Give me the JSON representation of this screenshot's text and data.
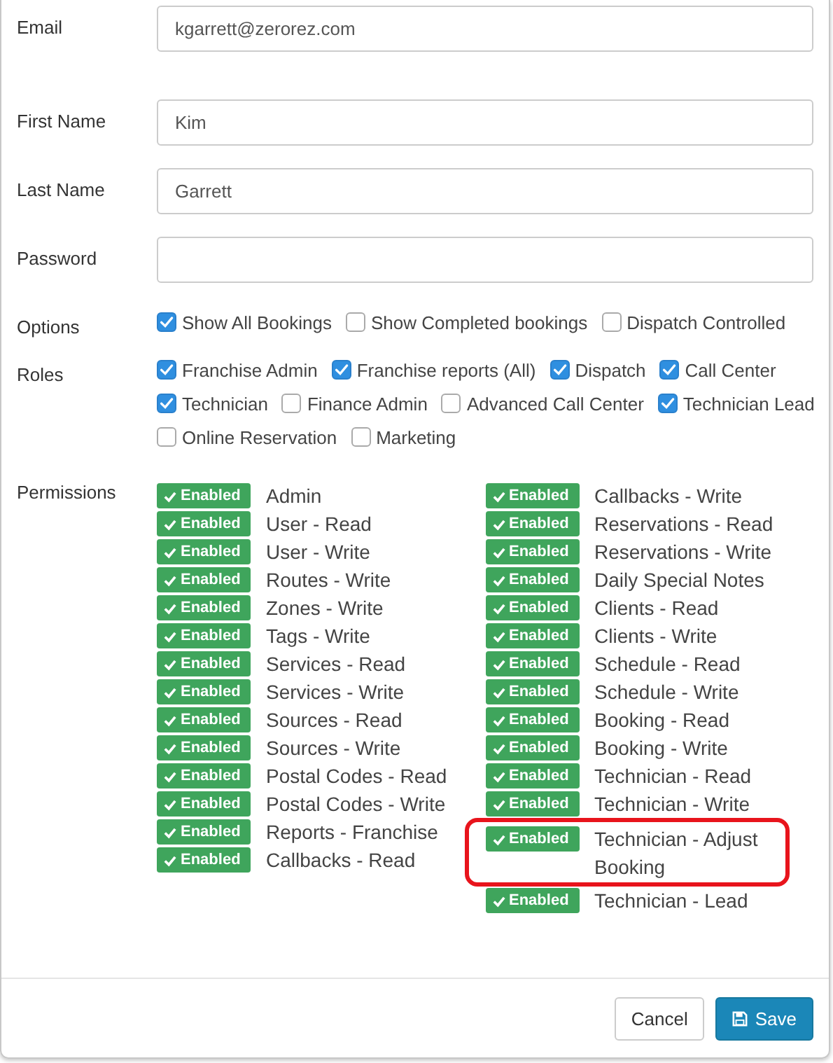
{
  "fields": [
    {
      "label": "Email",
      "value": "kgarrett@zerorez.com"
    },
    {
      "label": "First Name",
      "value": "Kim"
    },
    {
      "label": "Last Name",
      "value": "Garrett"
    },
    {
      "label": "Password"
    }
  ],
  "options": {
    "label": "Options",
    "rows": [
      [
        {
          "label": "Show All Bookings",
          "checked": true
        },
        {
          "label": "Show Completed bookings",
          "checked": false
        },
        {
          "label": "Dispatch Controlled",
          "checked": false
        }
      ]
    ]
  },
  "roles": {
    "label": "Roles",
    "rows": [
      [
        {
          "label": "Franchise Admin",
          "checked": true
        },
        {
          "label": "Franchise reports (All)",
          "checked": true
        },
        {
          "label": "Dispatch",
          "checked": true
        },
        {
          "label": "Call Center",
          "checked": true
        }
      ],
      [
        {
          "label": "Technician",
          "checked": true
        },
        {
          "label": "Finance Admin",
          "checked": false
        },
        {
          "label": "Advanced Call Center",
          "checked": false
        },
        {
          "label": "Technician Lead",
          "checked": true
        }
      ],
      [
        {
          "label": "Online Reservation",
          "checked": false
        },
        {
          "label": "Marketing",
          "checked": false
        }
      ]
    ]
  },
  "permissions": {
    "label": "Permissions",
    "columns": [
      [
        {
          "status": "Enabled",
          "enabled": true,
          "label": "Admin",
          "highlighted": false
        },
        {
          "status": "Enabled",
          "enabled": true,
          "label": "User - Read",
          "highlighted": false
        },
        {
          "status": "Enabled",
          "enabled": true,
          "label": "User - Write",
          "highlighted": false
        },
        {
          "status": "Enabled",
          "enabled": true,
          "label": "Routes - Write",
          "highlighted": false
        },
        {
          "status": "Enabled",
          "enabled": true,
          "label": "Zones - Write",
          "highlighted": false
        },
        {
          "status": "Enabled",
          "enabled": true,
          "label": "Tags - Write",
          "highlighted": false
        },
        {
          "status": "Enabled",
          "enabled": true,
          "label": "Services - Read",
          "highlighted": false
        },
        {
          "status": "Enabled",
          "enabled": true,
          "label": "Services - Write",
          "highlighted": false
        },
        {
          "status": "Enabled",
          "enabled": true,
          "label": "Sources - Read",
          "highlighted": false
        },
        {
          "status": "Enabled",
          "enabled": true,
          "label": "Sources - Write",
          "highlighted": false
        },
        {
          "status": "Enabled",
          "enabled": true,
          "label": "Postal Codes - Read",
          "highlighted": false
        },
        {
          "status": "Enabled",
          "enabled": true,
          "label": "Postal Codes - Write",
          "highlighted": false
        },
        {
          "status": "Enabled",
          "enabled": true,
          "label": "Reports - Franchise",
          "highlighted": false
        },
        {
          "status": "Enabled",
          "enabled": true,
          "label": "Callbacks - Read",
          "highlighted": false
        }
      ],
      [
        {
          "status": "Enabled",
          "enabled": true,
          "label": "Callbacks - Write",
          "highlighted": false
        },
        {
          "status": "Enabled",
          "enabled": true,
          "label": "Reservations - Read",
          "highlighted": false
        },
        {
          "status": "Enabled",
          "enabled": true,
          "label": "Reservations - Write",
          "highlighted": false
        },
        {
          "status": "Enabled",
          "enabled": true,
          "label": "Daily Special Notes",
          "highlighted": false
        },
        {
          "status": "Enabled",
          "enabled": true,
          "label": "Clients - Read",
          "highlighted": false
        },
        {
          "status": "Enabled",
          "enabled": true,
          "label": "Clients - Write",
          "highlighted": false
        },
        {
          "status": "Enabled",
          "enabled": true,
          "label": "Schedule - Read",
          "highlighted": false
        },
        {
          "status": "Enabled",
          "enabled": true,
          "label": "Schedule - Write",
          "highlighted": false
        },
        {
          "status": "Enabled",
          "enabled": true,
          "label": "Booking - Read",
          "highlighted": false
        },
        {
          "status": "Enabled",
          "enabled": true,
          "label": "Booking - Write",
          "highlighted": false
        },
        {
          "status": "Enabled",
          "enabled": true,
          "label": "Technician - Read",
          "highlighted": false
        },
        {
          "status": "Enabled",
          "enabled": true,
          "label": "Technician - Write",
          "highlighted": false
        },
        {
          "status": "Enabled",
          "enabled": true,
          "label": "Technician - Adjust Booking",
          "highlighted": true
        },
        {
          "status": "Enabled",
          "enabled": true,
          "label": "Technician - Lead",
          "highlighted": false
        }
      ]
    ]
  },
  "buttons": [
    {
      "label": "Cancel",
      "kind": "secondary"
    },
    {
      "label": "Save",
      "kind": "primary"
    }
  ]
}
